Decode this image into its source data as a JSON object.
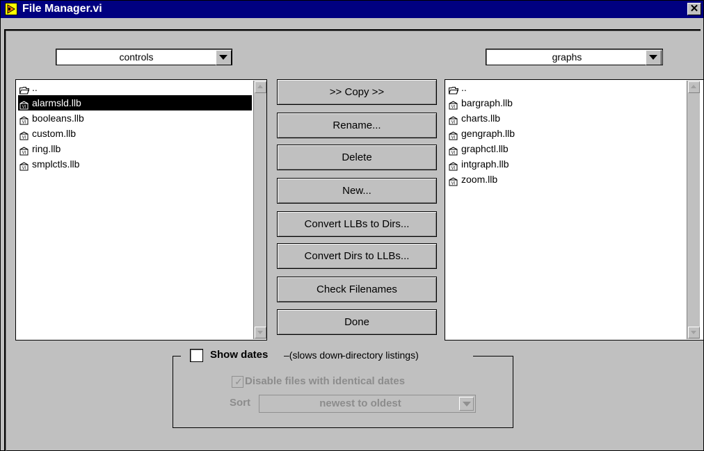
{
  "window": {
    "title": "File Manager.vi",
    "close_label": "✕"
  },
  "left_panel": {
    "dropdown_value": "controls",
    "items": [
      {
        "label": "..",
        "icon": "folder-up-icon",
        "selected": false
      },
      {
        "label": "alarmsld.llb",
        "icon": "vi-library-icon",
        "selected": true
      },
      {
        "label": "booleans.llb",
        "icon": "vi-library-icon",
        "selected": false
      },
      {
        "label": "custom.llb",
        "icon": "vi-library-icon",
        "selected": false
      },
      {
        "label": "ring.llb",
        "icon": "vi-library-icon",
        "selected": false
      },
      {
        "label": "smplctls.llb",
        "icon": "vi-library-icon",
        "selected": false
      }
    ]
  },
  "right_panel": {
    "dropdown_value": "graphs",
    "items": [
      {
        "label": "..",
        "icon": "folder-up-icon"
      },
      {
        "label": "bargraph.llb",
        "icon": "vi-library-icon"
      },
      {
        "label": "charts.llb",
        "icon": "vi-library-icon"
      },
      {
        "label": "gengraph.llb",
        "icon": "vi-library-icon"
      },
      {
        "label": "graphctl.llb",
        "icon": "vi-library-icon"
      },
      {
        "label": "intgraph.llb",
        "icon": "vi-library-icon"
      },
      {
        "label": "zoom.llb",
        "icon": "vi-library-icon"
      }
    ]
  },
  "buttons": {
    "copy": ">> Copy >>",
    "rename": "Rename...",
    "delete": "Delete",
    "new": "New...",
    "convert_llbs": "Convert LLBs to Dirs...",
    "convert_dirs": "Convert Dirs to LLBs...",
    "check": "Check Filenames",
    "done": "Done"
  },
  "options": {
    "show_dates_label": "Show dates",
    "show_dates_note": "–(slows down directory listings)",
    "show_dates_checked": false,
    "disable_identical_label": "Disable files with identical dates",
    "disable_identical_checked": true,
    "sort_label": "Sort",
    "sort_value": "newest to oldest"
  },
  "colors": {
    "face": "#c0c0c0",
    "titlebar": "#000080",
    "selection": "#000000",
    "disabled_text": "#8c8c8c"
  }
}
